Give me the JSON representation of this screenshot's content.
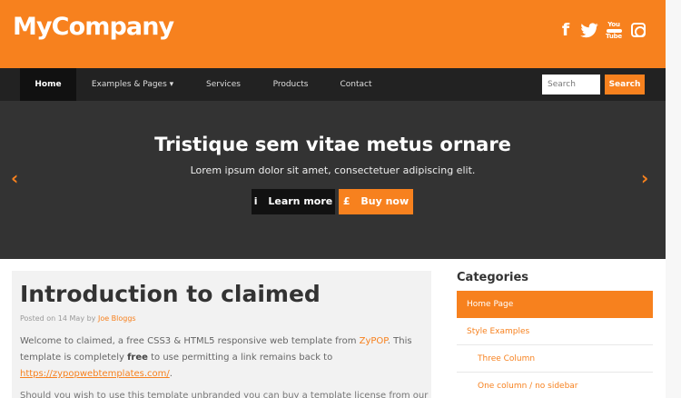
{
  "header": {
    "brand": "MyCompany",
    "social": {
      "facebook": "f",
      "twitter": "🐦",
      "youtube_top": "You",
      "youtube_bottom": "Tube",
      "instagram": ""
    }
  },
  "nav": {
    "items": [
      {
        "label": "Home"
      },
      {
        "label": "Examples & Pages ▾"
      },
      {
        "label": "Services"
      },
      {
        "label": "Products"
      },
      {
        "label": "Contact"
      }
    ],
    "search_placeholder": "Search",
    "search_button": "Search"
  },
  "hero": {
    "title": "Tristique sem vitae metus ornare",
    "subtitle": "Lorem ipsum dolor sit amet, consectetuer adipiscing elit.",
    "left_arrow": "‹",
    "right_arrow": "›",
    "learn_icon": "i",
    "learn_label": "Learn more",
    "buy_icon": "£",
    "buy_label": "Buy now"
  },
  "article": {
    "title": "Introduction to claimed",
    "meta_prefix": "Posted on 14 May by",
    "meta_author": "Joe Bloggs",
    "line1_before": "Welcome to claimed, a free CSS3 & HTML5 responsive web template from ",
    "line1_link": "ZyPOP",
    "line1_after": ". This",
    "line2_before": "template is completely ",
    "line2_bold": "free",
    "line2_after": " to use permitting a link remains back to",
    "line3_link": "https://zypopwebtemplates.com/",
    "line3_after": ".",
    "line4": "Should you wish to use this template unbranded you can buy a template license from our"
  },
  "sidebar": {
    "title": "Categories",
    "items": [
      {
        "label": "Home Page"
      },
      {
        "label": "Style Examples"
      },
      {
        "label": "Three Column"
      },
      {
        "label": "One column / no sidebar"
      }
    ]
  },
  "colors": {
    "accent": "#f7811e",
    "navbar": "#222222",
    "hero": "#333333"
  },
  "icons": [
    "facebook-icon",
    "twitter-icon",
    "youtube-icon",
    "instagram-icon",
    "chevron-left-icon",
    "chevron-right-icon",
    "info-icon",
    "pound-icon"
  ]
}
